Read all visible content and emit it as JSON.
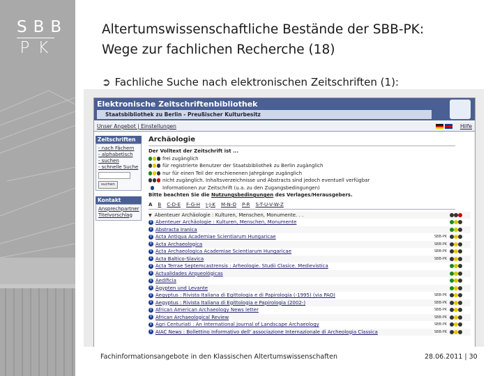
{
  "brand": {
    "line1": "SBB",
    "line2": "PK"
  },
  "slide": {
    "title_line1": "Altertumswissenschaftliche Bestände der SBB-PK:",
    "title_line2": "Wege zur fachlichen Recherche (18)",
    "bullet": "Fachliche Suche nach elektronischen Zeitschriften (1):"
  },
  "ezb": {
    "header_title": "Elektronische Zeitschriftenbibliothek",
    "header_sub": "Staatsbibliothek zu Berlin - Preußischer Kulturbesitz",
    "nav_links": "Unser Angebot | Einstellungen",
    "nav_help": "Hilfe",
    "sidebar_heading": "Zeitschriften",
    "sidebar_links": [
      "- nach Fächern",
      "- alphabetisch",
      "- suchen",
      "- schnelle Suche"
    ],
    "sidebar_button": "suchen",
    "contact_heading": "Kontakt",
    "contact_links": [
      "Ansprechpartner",
      "Titelvorschlag"
    ],
    "page_heading": "Archäologie",
    "legend_intro": "Der Volltext der Zeitschrift ist ...",
    "legend_items": [
      {
        "text": "frei zugänglich",
        "lights": [
          "#1a8a1a",
          "#cccc00",
          "#333333"
        ]
      },
      {
        "text": "für registrierte Benutzer der Staatsbibliothek zu Berlin zugänglich",
        "lights": [
          "#333333",
          "#e8c800",
          "#333333"
        ]
      },
      {
        "text": "nur für einen Teil der erschienenen Jahrgänge zugänglich",
        "lights": [
          "#1a8a1a",
          "#e8c800",
          "#333333"
        ]
      },
      {
        "text": "nicht zugänglich. Inhaltsverzeichnisse und Abstracts sind jedoch eventuell verfügbar",
        "lights": [
          "#333333",
          "#333333",
          "#d00000"
        ]
      }
    ],
    "info_note": "Informationen zur Zeitschrift (u.a. zu den Zugangsbedingungen)",
    "notice_pre": "Bitte beachten Sie die ",
    "notice_link": "Nutzungsbedingungen",
    "notice_post": " des Verlages/Herausgebers.",
    "letters": [
      "A",
      "B",
      "C-D-E",
      "F-G-H",
      "I-J-K",
      "M-N-O",
      "P-R",
      "S-T-U-V-W-Z"
    ],
    "active_letter": "A",
    "journals": [
      {
        "title": "Abenteuer Archäologie : Kulturen, Menschen, Monumente. . .",
        "first": true,
        "sb": false
      },
      {
        "title": "Abenteuer Archäologie : Kulturen, Menschen, Monumente",
        "sb": false
      },
      {
        "title": "Abstracta Iranica",
        "sb": false
      },
      {
        "title": "Acta Antiqua Academiae Scientiarum Hungaricae",
        "sb": true
      },
      {
        "title": "Acta Archaeologica",
        "sb": true
      },
      {
        "title": "Acta Archaeologica Academiae Scientiarum Hungaricae",
        "sb": true
      },
      {
        "title": "Acta Baltico-Slavica",
        "sb": true
      },
      {
        "title": "Acta Terrae Septemcastrensis : Arheologie. Studii Clasice. Medievistica",
        "sb": false
      },
      {
        "title": "Actualidades Arqueológicas",
        "sb": false
      },
      {
        "title": "Aedificia",
        "sb": false
      },
      {
        "title": "Ägypten und Levante",
        "sb": false
      },
      {
        "title": "Aegyptus : Rivista Italiana di Egittologia e di Papirologia (-1995) (via PAO)",
        "sb": true
      },
      {
        "title": "Aegyptus : Rivista Italiana di Egittologia e Papirologia (2002-)",
        "sb": true
      },
      {
        "title": "African American Archaeology News letter",
        "sb": true
      },
      {
        "title": "African Archaeological Review",
        "sb": true
      },
      {
        "title": "Agri Centuriati : An International Journal of Landscape Archaeology",
        "sb": true
      },
      {
        "title": "AIAC News : Bollettino Informativo dell' associazione Internazionale di Archeologia Classica",
        "sb": true
      }
    ],
    "sb_tag": "SBB-PK",
    "row_lights": [
      [
        "#333333",
        "#333333",
        "#d00000"
      ],
      [
        "#1a8a1a",
        "#cccc00",
        "#333333"
      ],
      [
        "#1a8a1a",
        "#cccc00",
        "#333333"
      ],
      [
        "#333333",
        "#e8c800",
        "#333333"
      ],
      [
        "#333333",
        "#e8c800",
        "#333333"
      ],
      [
        "#333333",
        "#e8c800",
        "#333333"
      ],
      [
        "#333333",
        "#e8c800",
        "#333333"
      ],
      [
        "#1a8a1a",
        "#cccc00",
        "#333333"
      ],
      [
        "#1a8a1a",
        "#cccc00",
        "#333333"
      ],
      [
        "#1a8a1a",
        "#cccc00",
        "#333333"
      ],
      [
        "#1a8a1a",
        "#e8c800",
        "#333333"
      ],
      [
        "#333333",
        "#e8c800",
        "#333333"
      ],
      [
        "#333333",
        "#e8c800",
        "#333333"
      ],
      [
        "#333333",
        "#e8c800",
        "#333333"
      ],
      [
        "#333333",
        "#e8c800",
        "#333333"
      ],
      [
        "#333333",
        "#e8c800",
        "#333333"
      ],
      [
        "#333333",
        "#e8c800",
        "#333333"
      ]
    ]
  },
  "footer": {
    "left": "Fachinformationsangebote in den Klassischen Altertumswissenschaften",
    "right": "28.06.2011 | 30"
  },
  "colors": {
    "sidebar_gray": "#a9a9a9",
    "ezb_blue": "#4a5f93"
  }
}
